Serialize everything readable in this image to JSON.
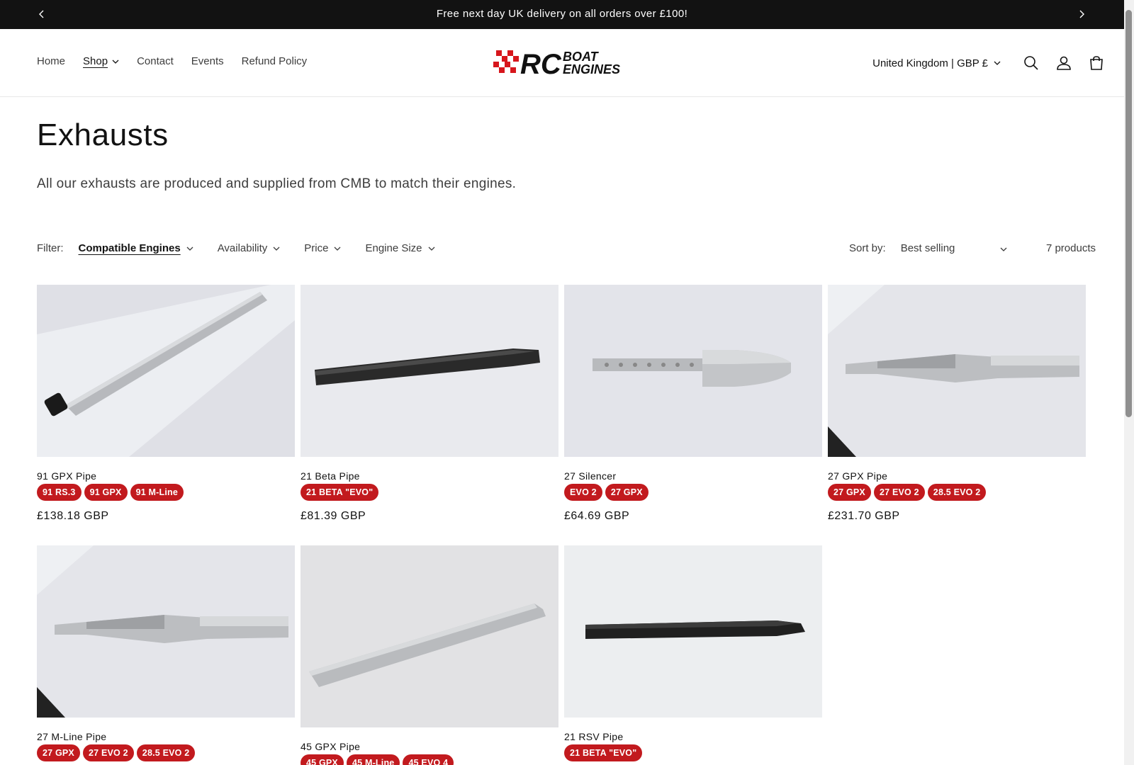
{
  "announcement": {
    "text": "Free next day UK delivery on all orders over £100!"
  },
  "nav": {
    "items": [
      {
        "label": "Home"
      },
      {
        "label": "Shop"
      },
      {
        "label": "Contact"
      },
      {
        "label": "Events"
      },
      {
        "label": "Refund Policy"
      }
    ]
  },
  "logo": {
    "rc": "RC",
    "boat": "BOAT",
    "engines": "ENGINES"
  },
  "header": {
    "locale": "United Kingdom | GBP £"
  },
  "collection": {
    "title": "Exhausts",
    "description": "All our exhausts are produced and supplied from CMB to match their engines."
  },
  "filters": {
    "label": "Filter:",
    "items": [
      {
        "label": "Compatible Engines"
      },
      {
        "label": "Availability"
      },
      {
        "label": "Price"
      },
      {
        "label": "Engine Size"
      }
    ],
    "sort_label": "Sort by:",
    "sort_value": "Best selling",
    "count": "7 products"
  },
  "products": [
    {
      "name": "91 GPX Pipe",
      "badges": [
        "91 RS.3",
        "91 GPX",
        "91 M-Line"
      ],
      "price": "£138.18 GBP"
    },
    {
      "name": "21 Beta Pipe",
      "badges": [
        "21 BETA \"EVO\""
      ],
      "price": "£81.39 GBP"
    },
    {
      "name": "27 Silencer",
      "badges": [
        "EVO 2",
        "27 GPX"
      ],
      "price": "£64.69 GBP"
    },
    {
      "name": "27 GPX Pipe",
      "badges": [
        "27 GPX",
        "27 EVO 2",
        "28.5 EVO 2"
      ],
      "price": "£231.70 GBP"
    },
    {
      "name": "27 M-Line Pipe",
      "badges": [
        "27 GPX",
        "27 EVO 2",
        "28.5 EVO 2"
      ],
      "price": ""
    },
    {
      "name": "45 GPX Pipe",
      "badges": [
        "45 GPX",
        "45 M-Line",
        "45 EVO 4"
      ],
      "price": ""
    },
    {
      "name": "21 RSV Pipe",
      "badges": [
        "21 BETA \"EVO\""
      ],
      "price": ""
    }
  ],
  "colors": {
    "badge": "#c21a1e",
    "announcement_bg": "#121212",
    "logo_red": "#d7161c"
  },
  "icons": [
    "chevron-left-icon",
    "chevron-right-icon",
    "chevron-down-icon",
    "search-icon",
    "account-icon",
    "cart-icon"
  ]
}
